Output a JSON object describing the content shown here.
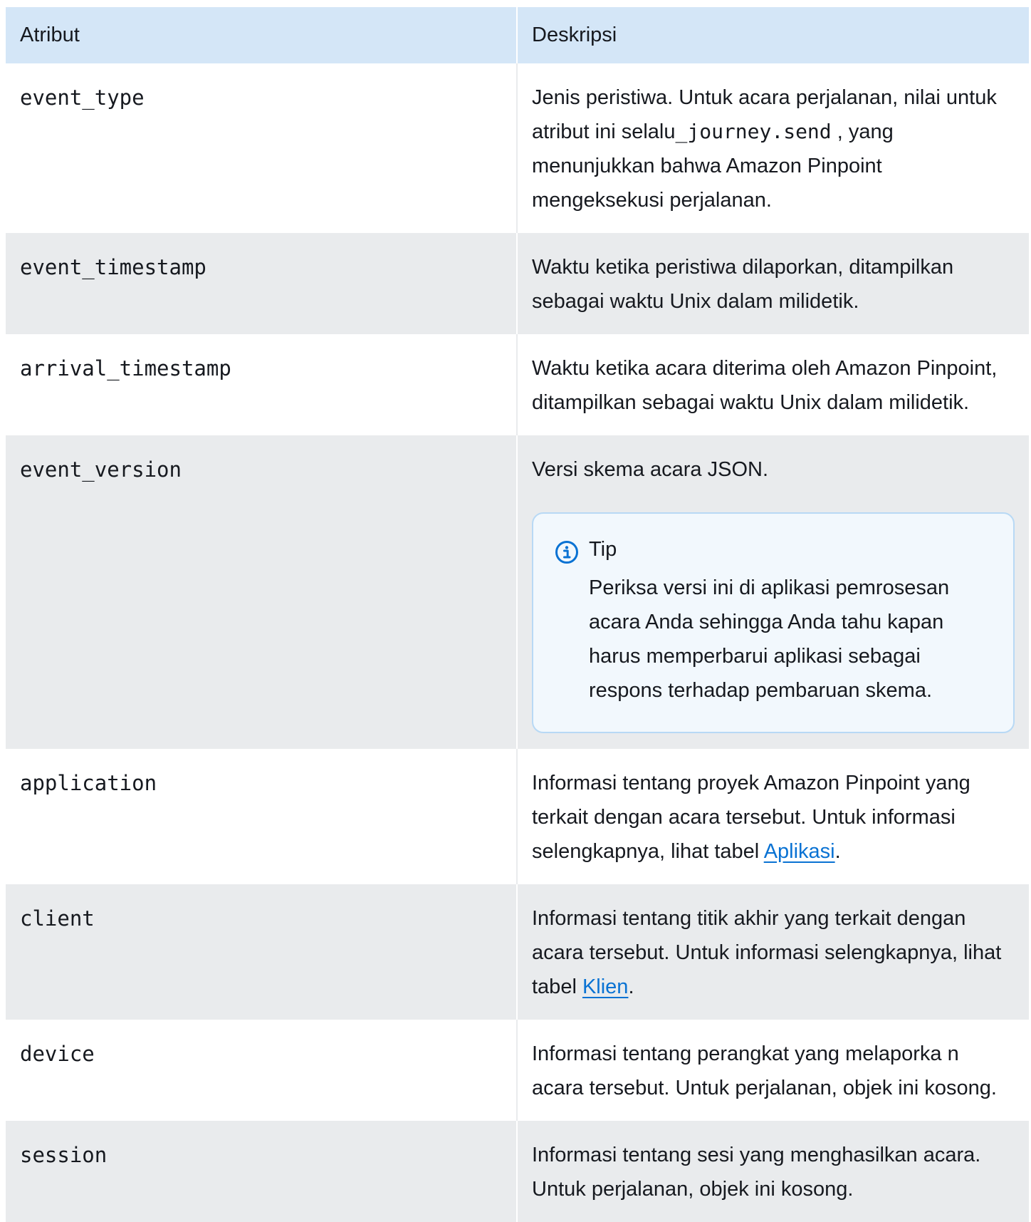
{
  "table": {
    "headers": {
      "attribute": "Atribut",
      "description": "Deskripsi"
    },
    "rows": [
      {
        "attribute": "event_type",
        "description_before": "Jenis peristiwa. Untuk acara perjalanan, nilai untuk atribut ini selalu",
        "code": "_journey.send",
        "description_after": " , yang menunjukkan bahwa Amazon Pinpoint mengeksekusi perjalanan."
      },
      {
        "attribute": "event_timestamp",
        "description": "Waktu ketika peristiwa dilaporkan, ditampilkan sebagai waktu Unix dalam milidetik."
      },
      {
        "attribute": "arrival_timestamp",
        "description": "Waktu ketika acara diterima oleh Amazon Pinpoint, ditampilkan sebagai waktu Unix dalam milidetik."
      },
      {
        "attribute": "event_version",
        "description": "Versi skema acara JSON.",
        "tip": {
          "icon": "info-icon",
          "title": "Tip",
          "text": "Periksa versi ini di aplikasi pemrosesan acara Anda sehingga Anda tahu kapan harus memperbarui aplikasi sebagai respons terhadap pembaruan skema."
        }
      },
      {
        "attribute": "application",
        "description_before": "Informasi tentang proyek Amazon Pinpoint yang terkait dengan acara tersebut. Untuk informasi selengkapnya, lihat tabel ",
        "link": "Aplikasi",
        "description_after": "."
      },
      {
        "attribute": "client",
        "description_before": "Informasi tentang titik akhir yang terkait dengan acara tersebut. Untuk informasi selengkapnya, lihat tabel ",
        "link": "Klien",
        "description_after": "."
      },
      {
        "attribute": "device",
        "description": "Informasi tentang perangkat yang melaporka n acara tersebut. Untuk perjalanan, objek ini kosong."
      },
      {
        "attribute": "session",
        "description": "Informasi tentang sesi yang menghasilkan acara. Untuk perjalanan, objek ini kosong."
      }
    ]
  },
  "colors": {
    "header_bg": "#d4e6f7",
    "alt_row_bg": "#e9ebed",
    "link": "#0972d3",
    "tip_bg": "#f2f8fd",
    "tip_border": "#b8d9f5",
    "info_icon": "#0972d3"
  }
}
